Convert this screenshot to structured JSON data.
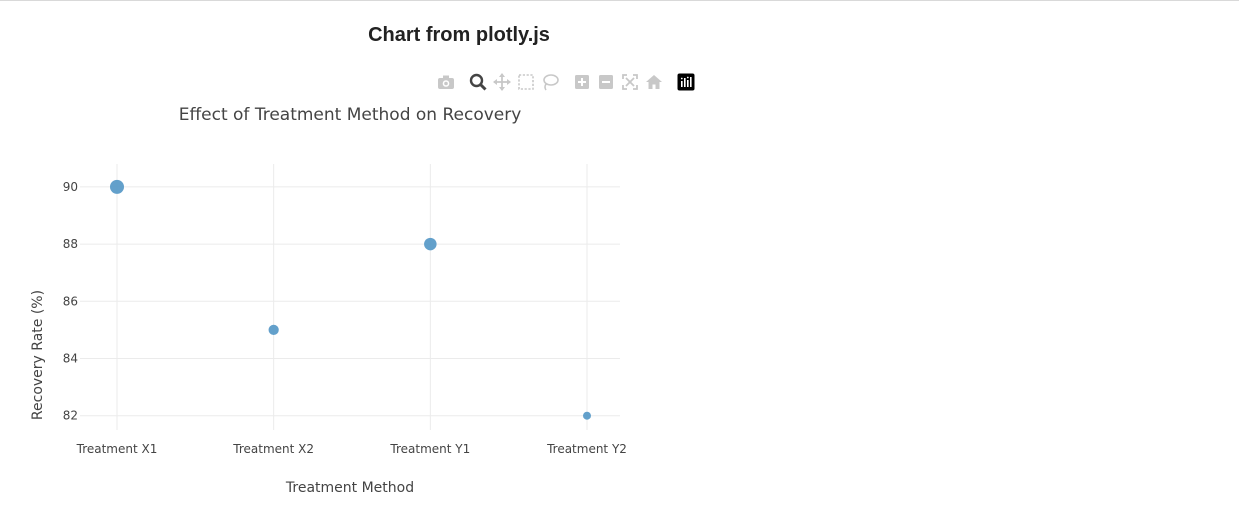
{
  "page": {
    "title": "Chart from plotly.js"
  },
  "modebar": {
    "icons": [
      "camera-icon",
      "zoom-icon",
      "pan-icon",
      "box-select-icon",
      "lasso-select-icon",
      "zoom-in-icon",
      "zoom-out-icon",
      "autoscale-icon",
      "reset-axes-icon",
      "plotly-logo-icon"
    ],
    "colors": {
      "idle": "#c8c8c8",
      "active": "#444444",
      "logo": "#000000"
    }
  },
  "chart_data": {
    "type": "scatter",
    "title": "Effect of Treatment Method on Recovery",
    "xlabel": "Treatment Method",
    "ylabel": "Recovery Rate (%)",
    "categories": [
      "Treatment X1",
      "Treatment X2",
      "Treatment Y1",
      "Treatment Y2"
    ],
    "values": [
      90,
      85,
      88,
      82
    ],
    "ylim": [
      81.5,
      90.8
    ],
    "yticks": [
      82,
      84,
      86,
      88,
      90
    ],
    "grid": true,
    "marker_color": "#5b9bc8"
  }
}
